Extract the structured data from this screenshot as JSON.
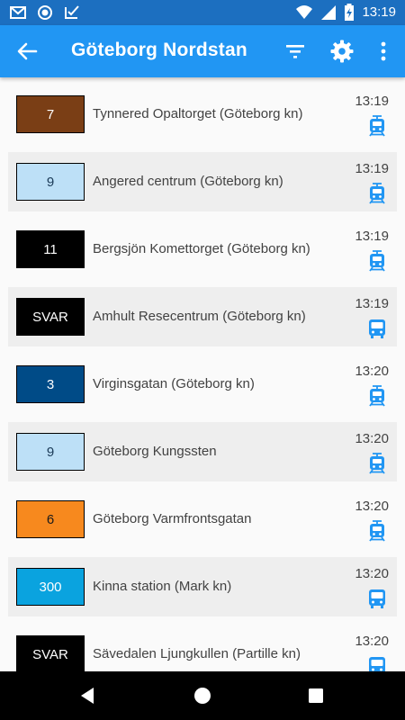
{
  "status_bar": {
    "time": "13:19",
    "left_icons": [
      "gmail-icon",
      "sync-icon",
      "tasks-check-icon"
    ],
    "right_icons": [
      "wifi-icon",
      "cell-signal-icon",
      "battery-charging-icon"
    ]
  },
  "app_bar": {
    "title": "Göteborg Nordstan",
    "actions": [
      "filter-icon",
      "settings-icon",
      "more-vert-icon"
    ]
  },
  "colors": {
    "status_bar": "#1c6fc0",
    "app_bar": "#2196f3",
    "icon_accent": "#2196f3"
  },
  "departures": [
    {
      "line": "7",
      "destination": "Tynnered Opaltorget (Göteborg kn)",
      "time": "13:19",
      "vehicle": "tram",
      "bg": "#7a3e15",
      "fg": "#ffffff"
    },
    {
      "line": "9",
      "destination": "Angered centrum (Göteborg kn)",
      "time": "13:19",
      "vehicle": "tram",
      "bg": "#bde0f7",
      "fg": "#1b3a57"
    },
    {
      "line": "11",
      "destination": "Bergsjön Komettorget (Göteborg kn)",
      "time": "13:19",
      "vehicle": "tram",
      "bg": "#000000",
      "fg": "#ffffff"
    },
    {
      "line": "SVAR",
      "destination": "Amhult Resecentrum (Göteborg kn)",
      "time": "13:19",
      "vehicle": "bus",
      "bg": "#000000",
      "fg": "#ffffff"
    },
    {
      "line": "3",
      "destination": "Virginsgatan (Göteborg kn)",
      "time": "13:20",
      "vehicle": "tram",
      "bg": "#004b87",
      "fg": "#ffffff"
    },
    {
      "line": "9",
      "destination": "Göteborg Kungssten",
      "time": "13:20",
      "vehicle": "tram",
      "bg": "#bde0f7",
      "fg": "#1b3a57"
    },
    {
      "line": "6",
      "destination": "Göteborg Varmfrontsgatan",
      "time": "13:20",
      "vehicle": "tram",
      "bg": "#f7891e",
      "fg": "#1b1b1b"
    },
    {
      "line": "300",
      "destination": "Kinna station (Mark kn)",
      "time": "13:20",
      "vehicle": "bus",
      "bg": "#0aa3df",
      "fg": "#ffffff"
    },
    {
      "line": "SVAR",
      "destination": "Sävedalen Ljungkullen (Partille kn)",
      "time": "13:20",
      "vehicle": "bus",
      "bg": "#000000",
      "fg": "#ffffff"
    }
  ],
  "nav_bar": {
    "buttons": [
      "back-triangle-icon",
      "home-circle-icon",
      "recents-square-icon"
    ]
  }
}
